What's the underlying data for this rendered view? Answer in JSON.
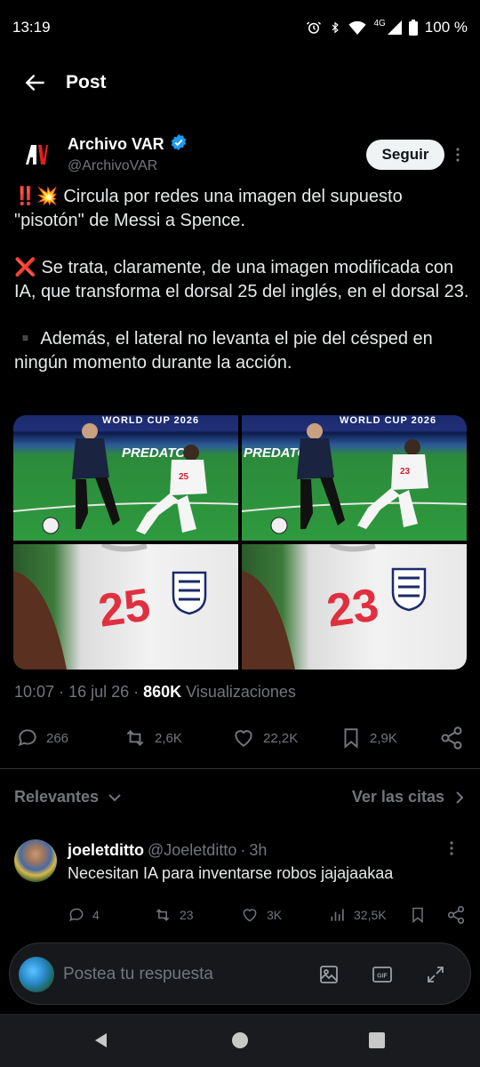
{
  "status_bar": {
    "time": "13:19",
    "network": "4G",
    "battery": "100 %"
  },
  "header": {
    "title": "Post"
  },
  "author": {
    "name": "Archivo VAR",
    "handle": "@ArchivoVAR",
    "follow_label": "Seguir",
    "verified": true
  },
  "tweet": {
    "p1": "‼️💥 Circula por redes una imagen del supuesto \"pisotón\" de Messi a Spence.",
    "p2": "❌ Se trata, claramente, de una imagen modificada con IA, que transforma el dorsal 25 del inglés, en el dorsal 23.",
    "p3": "▪️ Además, el lateral no levanta el pie del césped en ningún momento durante la acción."
  },
  "media": {
    "banner_text": "WORLD CUP 2026",
    "ad_left": "PREDATOR",
    "ad_right": "PREDATO",
    "jersey_number_left": "25",
    "jersey_number_right": "23"
  },
  "meta": {
    "time": "10:07",
    "date": "16 jul 26",
    "views": "860K",
    "views_label": "Visualizaciones"
  },
  "actions": {
    "replies": "266",
    "reposts": "2,6K",
    "likes": "22,2K",
    "bookmarks": "2,9K"
  },
  "relevant": {
    "sort_label": "Relevantes",
    "quotes_label": "Ver las citas"
  },
  "reply": {
    "name": "joeletditto",
    "handle": "@Joeletditto",
    "time": "3h",
    "text": "Necesitan IA para inventarse robos jajajaakaa",
    "replies": "4",
    "reposts": "23",
    "likes": "3K",
    "views": "32,5K"
  },
  "compose": {
    "placeholder": "Postea tu respuesta"
  },
  "colors": {
    "background": "#000000",
    "muted": "#71767b",
    "verified": "#1d9bf0",
    "follow_bg": "#eff3f4"
  }
}
